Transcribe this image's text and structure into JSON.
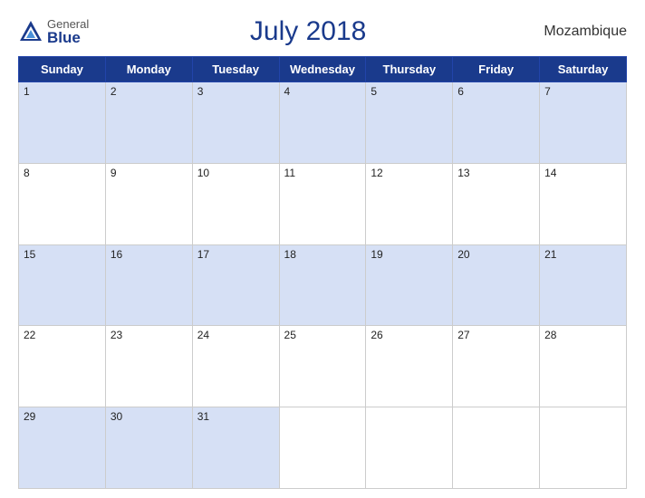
{
  "header": {
    "logo_general": "General",
    "logo_blue": "Blue",
    "title": "July 2018",
    "country": "Mozambique"
  },
  "days_of_week": [
    "Sunday",
    "Monday",
    "Tuesday",
    "Wednesday",
    "Thursday",
    "Friday",
    "Saturday"
  ],
  "weeks": [
    [
      1,
      2,
      3,
      4,
      5,
      6,
      7
    ],
    [
      8,
      9,
      10,
      11,
      12,
      13,
      14
    ],
    [
      15,
      16,
      17,
      18,
      19,
      20,
      21
    ],
    [
      22,
      23,
      24,
      25,
      26,
      27,
      28
    ],
    [
      29,
      30,
      31,
      null,
      null,
      null,
      null
    ]
  ]
}
